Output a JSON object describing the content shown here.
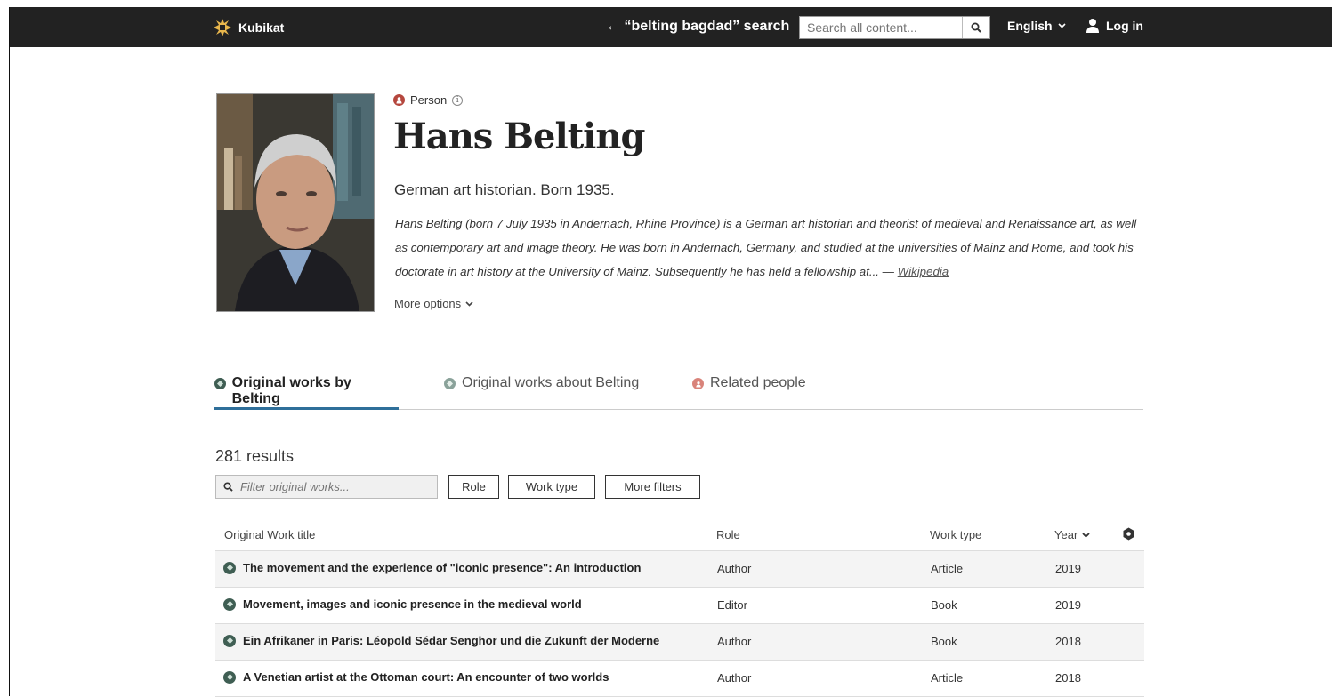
{
  "header": {
    "logo_text": "Kubikat",
    "back_search": "← “belting bagdad” search",
    "search_placeholder": "Search all content...",
    "language": "English",
    "login": "Log in"
  },
  "profile": {
    "type": "Person",
    "name": "Hans Belting",
    "subtitle": "German art historian. Born 1935.",
    "bio": "Hans Belting (born 7 July 1935 in Andernach, Rhine Province) is a German art historian and theorist of medieval and Renaissance art, as well as contemporary art and image theory. He was born in Andernach, Germany, and studied at the universities of Mainz and Rome, and took his doctorate in art history at the University of Mainz. Subsequently he has held a fellowship at... — ",
    "bio_link": "Wikipedia",
    "more_options": "More options"
  },
  "tabs": [
    {
      "label": "Original works by Belting",
      "color": "#3f5e53"
    },
    {
      "label": "Original works about Belting",
      "color": "#8aa29a"
    },
    {
      "label": "Related people",
      "color": "#d9837a"
    }
  ],
  "results": {
    "count": "281 results",
    "filter_placeholder": "Filter original works...",
    "buttons": [
      "Role",
      "Work type",
      "More filters"
    ]
  },
  "table": {
    "headers": [
      "Original Work title",
      "Role",
      "Work type",
      "Year"
    ],
    "rows": [
      {
        "title": "The movement and the experience of \"iconic presence\": An introduction",
        "role": "Author",
        "type": "Article",
        "year": "2019"
      },
      {
        "title": "Movement, images and iconic presence in the medieval world",
        "role": "Editor",
        "type": "Book",
        "year": "2019"
      },
      {
        "title": "Ein Afrikaner in Paris: Léopold Sédar Senghor und die Zukunft der Moderne",
        "role": "Author",
        "type": "Book",
        "year": "2018"
      },
      {
        "title": "A Venetian artist at the Ottoman court: An encounter of two worlds",
        "role": "Author",
        "type": "Article",
        "year": "2018"
      }
    ]
  }
}
